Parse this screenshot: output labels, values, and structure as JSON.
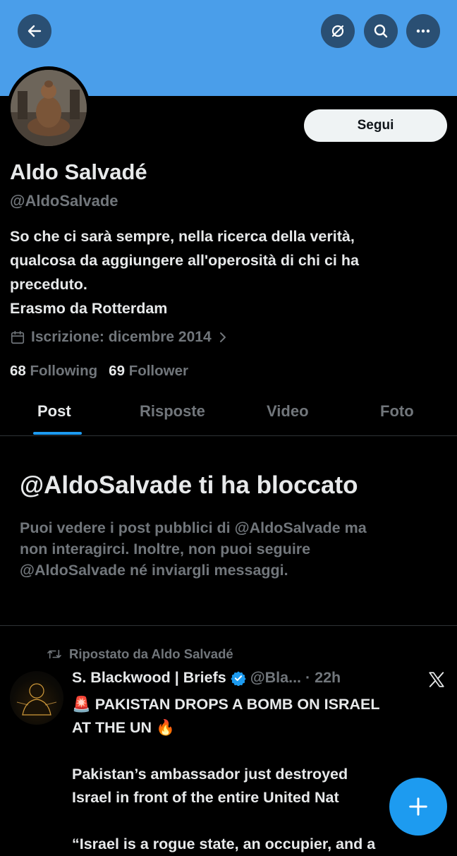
{
  "header": {
    "back_icon": "arrow-left-icon",
    "rotate_icon": "slashed-circle-icon",
    "search_icon": "search-icon",
    "more_icon": "more-dots-icon"
  },
  "profile": {
    "follow_label": "Segui",
    "name": "Aldo Salvadé",
    "handle": "@AldoSalvade",
    "bio": [
      "So che ci sarà sempre, nella ricerca della verità,",
      "qualcosa da aggiungere all'operosità di chi ci ha",
      "preceduto.",
      "Erasmo da Rotterdam"
    ],
    "joined": "Iscrizione: dicembre 2014",
    "following_count": "68",
    "following_label": "Following",
    "followers_count": "69",
    "followers_label": "Follower"
  },
  "tabs": [
    "Post",
    "Risposte",
    "Video",
    "Foto"
  ],
  "blocked": {
    "title": "@AldoSalvade ti ha bloccato",
    "text": [
      "Puoi vedere i post pubblici di @AldoSalvade ma",
      "non interagirci. Inoltre, non puoi seguire",
      "@AldoSalvade né inviargli messaggi."
    ]
  },
  "post": {
    "repost_label": "Ripostato da Aldo Salvadé",
    "author": "S. Blackwood | Briefs",
    "handle_time": "@Bla... · 22h",
    "lines": [
      "🚨 PAKISTAN DROPS A BOMB ON ISRAEL",
      "AT THE UN 🔥",
      "",
      "Pakistan’s ambassador just destroyed",
      "Israel in front of the entire United Nat",
      "",
      "“Israel is a rogue state, an occupier, and a"
    ]
  },
  "colors": {
    "banner": "#4a9eea",
    "accent": "#1d9bf0",
    "muted": "#71767b"
  }
}
